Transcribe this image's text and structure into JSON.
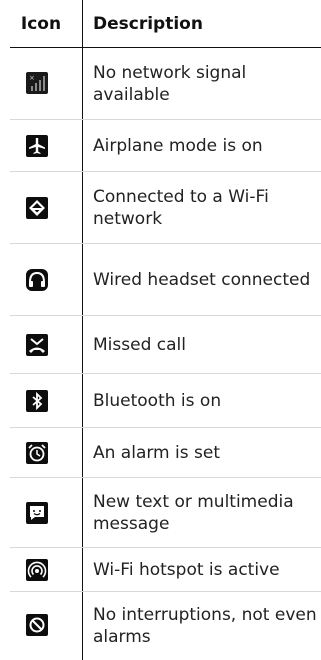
{
  "headers": {
    "icon": "Icon",
    "description": "Description"
  },
  "rows": [
    {
      "icon": "no-signal-icon",
      "description": "No network signal available"
    },
    {
      "icon": "airplane-icon",
      "description": "Airplane mode is on"
    },
    {
      "icon": "wifi-icon",
      "description": "Connected to a Wi-Fi network"
    },
    {
      "icon": "headset-icon",
      "description": "Wired headset connected"
    },
    {
      "icon": "missed-call-icon",
      "description": "Missed call"
    },
    {
      "icon": "bluetooth-icon",
      "description": "Bluetooth is on"
    },
    {
      "icon": "alarm-icon",
      "description": "An alarm is set"
    },
    {
      "icon": "message-icon",
      "description": "New text or multimedia message"
    },
    {
      "icon": "hotspot-icon",
      "description": "Wi-Fi hotspot is active"
    },
    {
      "icon": "no-interruptions-icon",
      "description": "No interruptions, not even alarms"
    }
  ]
}
